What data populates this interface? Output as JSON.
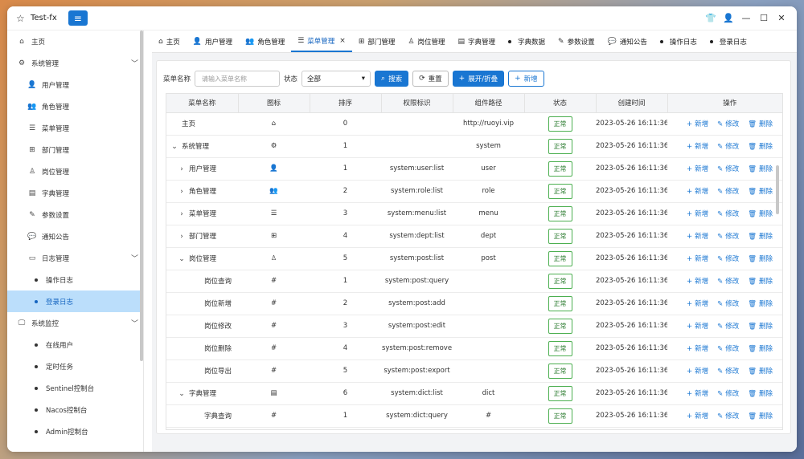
{
  "window": {
    "title": "Test-fx",
    "app_icon": "star-icon",
    "menu_icon": "hamburger-icon"
  },
  "titlebar_icons": [
    "shirt-icon",
    "user-icon",
    "minimize-icon",
    "maximize-icon",
    "close-icon"
  ],
  "sidebar": {
    "items": [
      {
        "label": "主页",
        "icon": "⌂",
        "level": 0
      },
      {
        "label": "系统管理",
        "icon": "⚙",
        "level": 0,
        "chevron": "﹀"
      },
      {
        "label": "用户管理",
        "icon": "👤",
        "level": 1
      },
      {
        "label": "角色管理",
        "icon": "👥",
        "level": 1
      },
      {
        "label": "菜单管理",
        "icon": "☰",
        "level": 1
      },
      {
        "label": "部门管理",
        "icon": "⊞",
        "level": 1
      },
      {
        "label": "岗位管理",
        "icon": "♙",
        "level": 1
      },
      {
        "label": "字典管理",
        "icon": "▤",
        "level": 1
      },
      {
        "label": "参数设置",
        "icon": "✎",
        "level": 1
      },
      {
        "label": "通知公告",
        "icon": "💬",
        "level": 1
      },
      {
        "label": "日志管理",
        "icon": "▭",
        "level": 1,
        "chevron": "﹀"
      },
      {
        "label": "操作日志",
        "level": 2
      },
      {
        "label": "登录日志",
        "level": 2,
        "active": true
      },
      {
        "label": "系统监控",
        "icon": "🖵",
        "level": 0,
        "chevron": "﹀"
      },
      {
        "label": "在线用户",
        "level": 2
      },
      {
        "label": "定时任务",
        "level": 2
      },
      {
        "label": "Sentinel控制台",
        "level": 2
      },
      {
        "label": "Nacos控制台",
        "level": 2
      },
      {
        "label": "Admin控制台",
        "level": 2
      }
    ]
  },
  "tabs": [
    {
      "label": "主页",
      "icon": "⌂"
    },
    {
      "label": "用户管理",
      "icon": "👤"
    },
    {
      "label": "角色管理",
      "icon": "👥"
    },
    {
      "label": "菜单管理",
      "icon": "☰",
      "active": true,
      "close": "×"
    },
    {
      "label": "部门管理",
      "icon": "⊞"
    },
    {
      "label": "岗位管理",
      "icon": "♙"
    },
    {
      "label": "字典管理",
      "icon": "▤"
    },
    {
      "label": "字典数据",
      "dot": true
    },
    {
      "label": "参数设置",
      "icon": "✎"
    },
    {
      "label": "通知公告",
      "icon": "💬"
    },
    {
      "label": "操作日志",
      "dot": true
    },
    {
      "label": "登录日志",
      "dot": true
    }
  ],
  "toolbar": {
    "name_label": "菜单名称",
    "name_placeholder": "请输入菜单名称",
    "status_label": "状态",
    "status_value": "全部",
    "search_label": "搜索",
    "reset_label": "重置",
    "expand_label": "展开/折叠",
    "add_label": "新增"
  },
  "table": {
    "columns": [
      "菜单名称",
      "图标",
      "排序",
      "权限标识",
      "组件路径",
      "状态",
      "创建时间",
      "操作"
    ],
    "ops": {
      "add": "新增",
      "edit": "修改",
      "delete": "删除"
    },
    "rows": [
      {
        "name": "主页",
        "indent": 0,
        "expand": "",
        "icon": "⌂",
        "order": "0",
        "perm": "",
        "path": "http://ruoyi.vip",
        "status": "正常",
        "time": "2023-05-26 16:11:36"
      },
      {
        "name": "系统管理",
        "indent": 0,
        "expand": "⌄",
        "icon": "⚙",
        "order": "1",
        "perm": "",
        "path": "system",
        "status": "正常",
        "time": "2023-05-26 16:11:36"
      },
      {
        "name": "用户管理",
        "indent": 1,
        "expand": "›",
        "icon": "👤",
        "order": "1",
        "perm": "system:user:list",
        "path": "user",
        "status": "正常",
        "time": "2023-05-26 16:11:36"
      },
      {
        "name": "角色管理",
        "indent": 1,
        "expand": "›",
        "icon": "👥",
        "order": "2",
        "perm": "system:role:list",
        "path": "role",
        "status": "正常",
        "time": "2023-05-26 16:11:36"
      },
      {
        "name": "菜单管理",
        "indent": 1,
        "expand": "›",
        "icon": "☰",
        "order": "3",
        "perm": "system:menu:list",
        "path": "menu",
        "status": "正常",
        "time": "2023-05-26 16:11:36"
      },
      {
        "name": "部门管理",
        "indent": 1,
        "expand": "›",
        "icon": "⊞",
        "order": "4",
        "perm": "system:dept:list",
        "path": "dept",
        "status": "正常",
        "time": "2023-05-26 16:11:36"
      },
      {
        "name": "岗位管理",
        "indent": 1,
        "expand": "⌄",
        "icon": "♙",
        "order": "5",
        "perm": "system:post:list",
        "path": "post",
        "status": "正常",
        "time": "2023-05-26 16:11:36"
      },
      {
        "name": "岗位查询",
        "indent": 2,
        "expand": "",
        "icon": "#",
        "order": "1",
        "perm": "system:post:query",
        "path": "",
        "status": "正常",
        "time": "2023-05-26 16:11:36"
      },
      {
        "name": "岗位新增",
        "indent": 2,
        "expand": "",
        "icon": "#",
        "order": "2",
        "perm": "system:post:add",
        "path": "",
        "status": "正常",
        "time": "2023-05-26 16:11:36"
      },
      {
        "name": "岗位修改",
        "indent": 2,
        "expand": "",
        "icon": "#",
        "order": "3",
        "perm": "system:post:edit",
        "path": "",
        "status": "正常",
        "time": "2023-05-26 16:11:36"
      },
      {
        "name": "岗位删除",
        "indent": 2,
        "expand": "",
        "icon": "#",
        "order": "4",
        "perm": "system:post:remove",
        "path": "",
        "status": "正常",
        "time": "2023-05-26 16:11:36"
      },
      {
        "name": "岗位导出",
        "indent": 2,
        "expand": "",
        "icon": "#",
        "order": "5",
        "perm": "system:post:export",
        "path": "",
        "status": "正常",
        "time": "2023-05-26 16:11:36"
      },
      {
        "name": "字典管理",
        "indent": 1,
        "expand": "⌄",
        "icon": "▤",
        "order": "6",
        "perm": "system:dict:list",
        "path": "dict",
        "status": "正常",
        "time": "2023-05-26 16:11:36"
      },
      {
        "name": "字典查询",
        "indent": 2,
        "expand": "",
        "icon": "#",
        "order": "1",
        "perm": "system:dict:query",
        "path": "#",
        "status": "正常",
        "time": "2023-05-26 16:11:36"
      }
    ]
  }
}
